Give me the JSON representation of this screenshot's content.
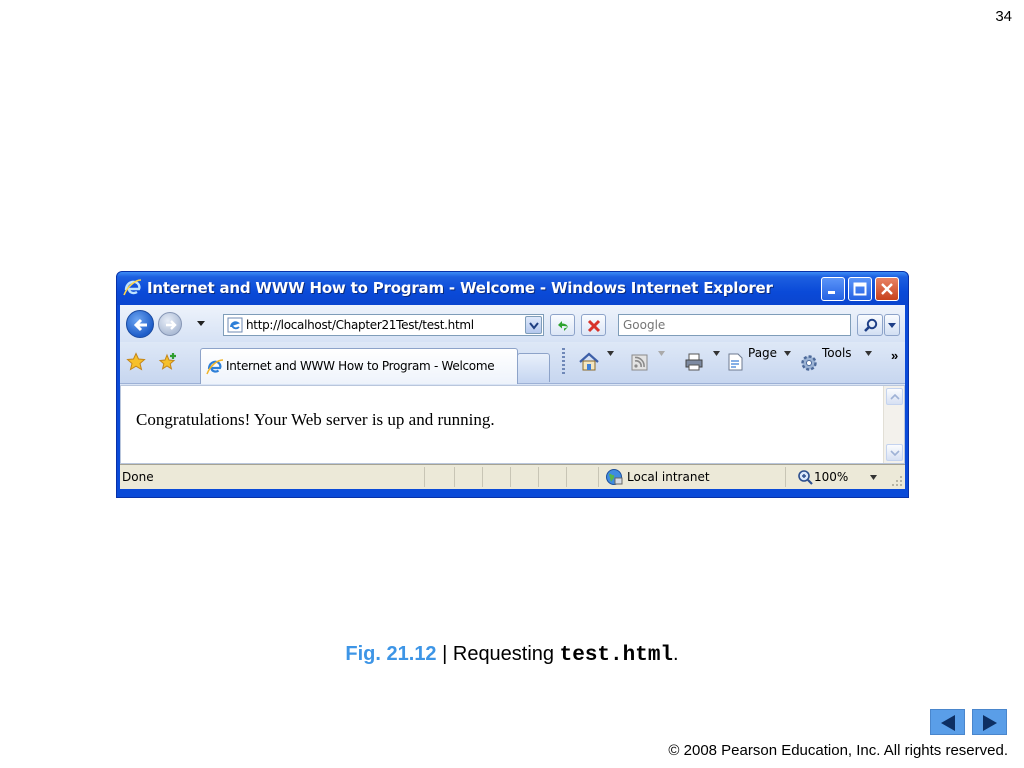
{
  "slide": {
    "number": "34"
  },
  "window": {
    "title": "Internet and WWW How to Program - Welcome - Windows Internet Explorer",
    "address": "http://localhost/Chapter21Test/test.html",
    "search_placeholder": "Google",
    "tab_label": "Internet and WWW How to Program - Welcome",
    "commands": {
      "page": "Page",
      "tools": "Tools",
      "more": "»"
    },
    "content_text": "Congratulations! Your Web server is up and running.",
    "status": {
      "text": "Done",
      "zone": "Local intranet",
      "zoom": "100%"
    }
  },
  "caption": {
    "figure": "Fig. 21.12",
    "separator": " | Requesting ",
    "code": "test.html",
    "end": "."
  },
  "footer": {
    "copyright": "© 2008 Pearson Education, Inc.  All rights reserved."
  },
  "icons": [
    "ie-logo-icon",
    "back-arrow-icon",
    "forward-arrow-icon",
    "refresh-icon",
    "stop-icon",
    "search-icon",
    "favorites-star-icon",
    "add-favorites-icon",
    "home-icon",
    "feeds-icon",
    "print-icon",
    "page-icon",
    "tools-gear-icon",
    "globe-icon",
    "magnifier-icon",
    "prev-slide-icon",
    "next-slide-icon"
  ],
  "colors": {
    "titlebar": "#0a4ad8",
    "caption_accent": "#3d95e6",
    "nav_button": "#5a9ee8"
  }
}
